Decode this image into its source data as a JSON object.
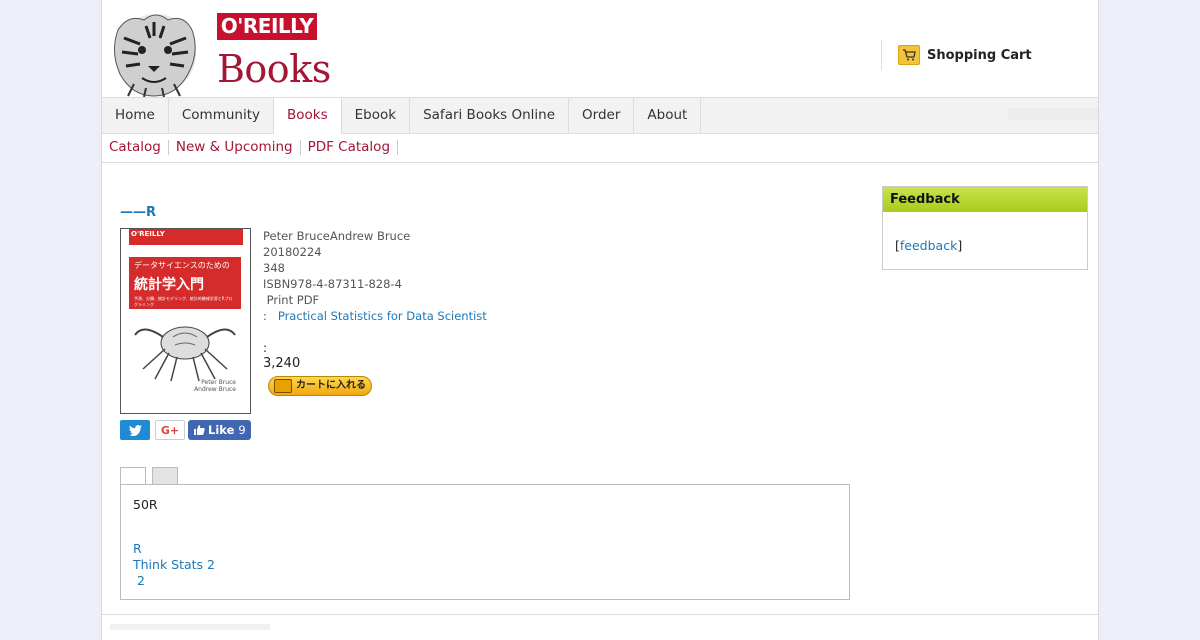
{
  "header": {
    "logo_badge": "O'REILLY",
    "logo_books": "Books",
    "cart_label": "Shopping Cart",
    "tiger_icon": "tiger-logo-icon",
    "cart_icon": "shopping-cart-icon"
  },
  "nav": {
    "items": [
      {
        "label": "Home"
      },
      {
        "label": "Community"
      },
      {
        "label": "Books"
      },
      {
        "label": "Ebook"
      },
      {
        "label": "Safari Books Online"
      },
      {
        "label": "Order"
      },
      {
        "label": "About"
      }
    ],
    "active": "Books"
  },
  "subnav": {
    "items": [
      {
        "label": "Catalog"
      },
      {
        "label": "New & Upcoming"
      },
      {
        "label": "PDF Catalog"
      }
    ]
  },
  "book": {
    "title": "——R",
    "cover": {
      "publisher": "O'REILLY",
      "band_small": "データサイエンスのための",
      "band_big": "統計学入門",
      "band_sub": "予測、分類、統計モデリング、統計的機械学習とRプログラミング",
      "authors": "Peter Bruce\nAndrew Bruce",
      "illustration_icon": "crab-illustration-icon"
    },
    "authors": "Peter BruceAndrew Bruce",
    "date": "20180224",
    "pages": "348",
    "isbn": "ISBN978-4-87311-828-4",
    "formats": " Print PDF",
    "original_prefix": ":",
    "original_title": "Practical Statistics for Data Scientist",
    "price_colon": ":",
    "price": "3,240",
    "cart_button": "カートに入れる"
  },
  "social": {
    "twitter_icon": "twitter-icon",
    "gplus_label": "G+",
    "like_label": "Like",
    "like_count": "9"
  },
  "tab_panel": {
    "description": "50R",
    "links": [
      {
        "label": "R"
      },
      {
        "label": "Think Stats 2"
      },
      {
        "label": " 2"
      }
    ]
  },
  "sidebar": {
    "feedback_title": "Feedback",
    "feedback_open": "[",
    "feedback_link": "feedback",
    "feedback_close": "]"
  },
  "colors": {
    "brand_red": "#c8102e",
    "books_red": "#a31636",
    "link_blue": "#1e77b8",
    "feedback_green": "#b5d62a"
  }
}
